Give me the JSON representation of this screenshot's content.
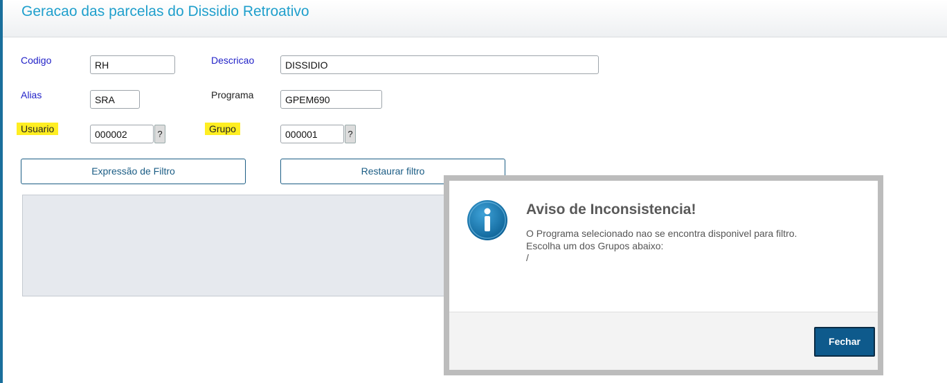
{
  "page": {
    "title": "Geracao das parcelas do Dissidio Retroativo"
  },
  "form": {
    "codigo": {
      "label": "Codigo",
      "value": "RH"
    },
    "descricao": {
      "label": "Descricao",
      "value": "DISSIDIO"
    },
    "alias": {
      "label": "Alias",
      "value": "SRA"
    },
    "programa": {
      "label": "Programa",
      "value": "GPEM690"
    },
    "usuario": {
      "label": "Usuario",
      "value": "000002",
      "help": "?"
    },
    "grupo": {
      "label": "Grupo",
      "value": "000001",
      "help": "?"
    }
  },
  "buttons": {
    "filter_expression": "Expressão de Filtro",
    "restore_filter": "Restaurar filtro"
  },
  "dialog": {
    "title": "Aviso de Inconsistencia!",
    "line1": "O Programa selecionado nao se encontra disponivel para filtro.",
    "line2": "Escolha um dos Grupos abaixo:",
    "line3": "/",
    "close_label": "Fechar",
    "icon": "info-icon"
  },
  "colors": {
    "accent": "#1f9fcc",
    "label_blue": "#2222c8",
    "highlight": "#ffee22",
    "primary_button": "#0e5a8c"
  }
}
